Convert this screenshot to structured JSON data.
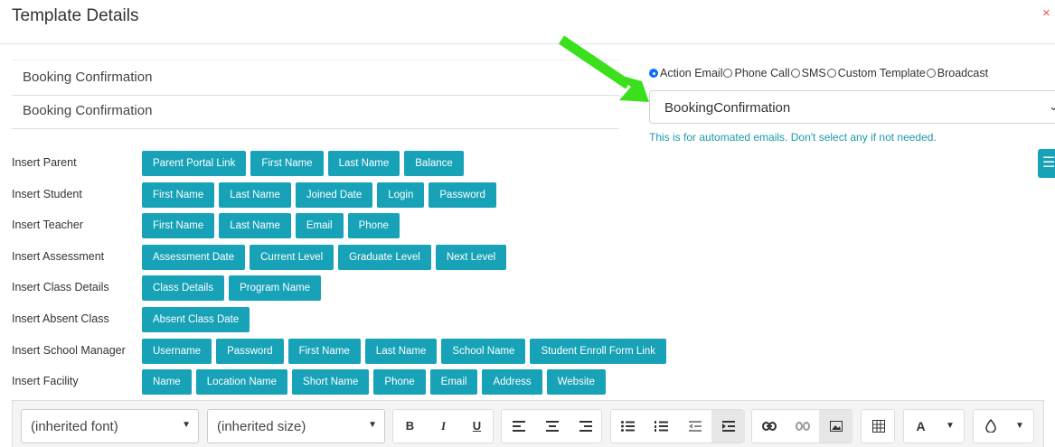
{
  "dialog": {
    "title": "Template Details",
    "close_label": "×"
  },
  "fields": {
    "name": "Booking Confirmation",
    "subject": "Booking Confirmation"
  },
  "template_types": [
    "Action Email",
    "Phone Call",
    "SMS",
    "Custom Template",
    "Broadcast"
  ],
  "selected_type": "Action Email",
  "action_select": {
    "value": "BookingConfirmation",
    "chevron": "⌄"
  },
  "helper_text": "This is for automated emails. Don't select any if not needed.",
  "side_button_icon": "☰",
  "insert_rows": [
    {
      "label": "Insert Parent",
      "buttons": [
        "Parent Portal Link",
        "First Name",
        "Last Name",
        "Balance"
      ]
    },
    {
      "label": "Insert Student",
      "buttons": [
        "First Name",
        "Last Name",
        "Joined Date",
        "Login",
        "Password"
      ]
    },
    {
      "label": "Insert Teacher",
      "buttons": [
        "First Name",
        "Last Name",
        "Email",
        "Phone"
      ]
    },
    {
      "label": "Insert Assessment",
      "buttons": [
        "Assessment Date",
        "Current Level",
        "Graduate Level",
        "Next Level"
      ]
    },
    {
      "label": "Insert Class Details",
      "buttons": [
        "Class Details",
        "Program Name"
      ]
    },
    {
      "label": "Insert Absent Class",
      "buttons": [
        "Absent Class Date"
      ]
    },
    {
      "label": "Insert School Manager",
      "buttons": [
        "Username",
        "Password",
        "First Name",
        "Last Name",
        "School Name",
        "Student Enroll Form Link"
      ]
    },
    {
      "label": "Insert Facility",
      "buttons": [
        "Name",
        "Location Name",
        "Short Name",
        "Phone",
        "Email",
        "Address",
        "Website"
      ]
    }
  ],
  "editor_toolbar": {
    "font": "(inherited font)",
    "size": "(inherited size)",
    "bold": "B",
    "italic": "I",
    "underline": "U",
    "color_letter": "A",
    "icons": [
      "bold-icon",
      "italic-icon",
      "underline-icon",
      "align-left-icon",
      "align-center-icon",
      "align-right-icon",
      "bullet-list-icon",
      "numbered-list-icon",
      "outdent-icon",
      "indent-icon",
      "link-icon",
      "unlink-icon",
      "image-icon",
      "table-icon",
      "font-color-icon",
      "highlight-icon"
    ]
  },
  "colors": {
    "accent": "#17a2b8",
    "arrow": "#39e01b",
    "close": "#e0595a",
    "radio_selected": "#0d6efd"
  }
}
